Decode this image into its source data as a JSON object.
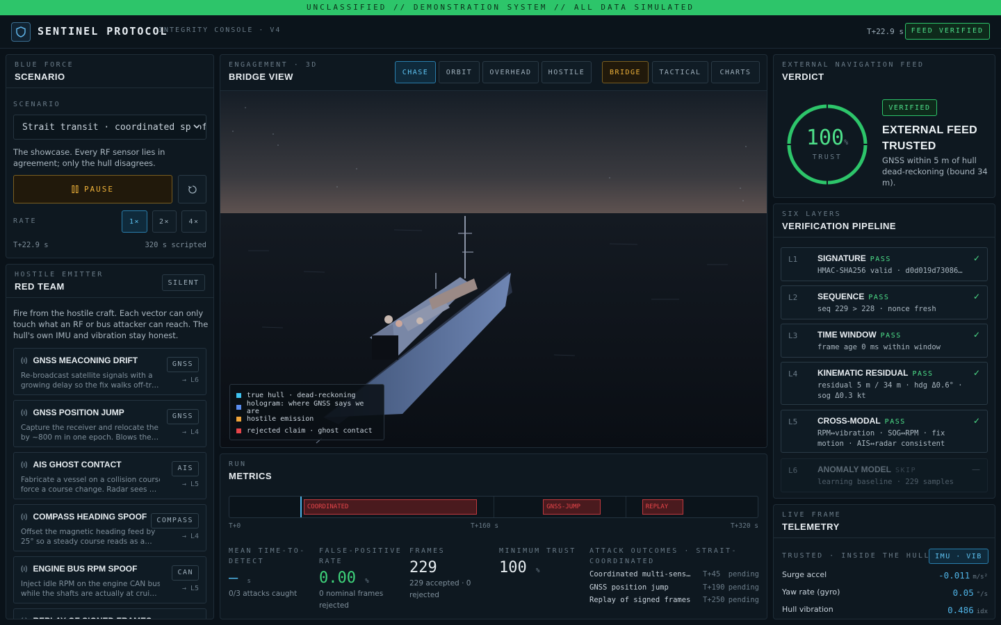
{
  "banner": "UNCLASSIFIED // DEMONSTRATION SYSTEM // ALL DATA SIMULATED",
  "header": {
    "title": "SENTINEL PROTOCOL",
    "subtitle": "INTEGRITY CONSOLE · V4",
    "clock": "T+22.9 s",
    "feed_badge": "FEED VERIFIED"
  },
  "blue_force": {
    "eyebrow": "BLUE FORCE",
    "title": "SCENARIO",
    "scenario_label": "SCENARIO",
    "scenario_value": "Strait transit · coordinated spoof",
    "scenario_desc": "The showcase. Every RF sensor lies in agreement; only the hull disagrees.",
    "pause_label": "PAUSE",
    "rate_label": "RATE",
    "rates": [
      "1×",
      "2×",
      "4×"
    ],
    "time": "T+22.9 s",
    "scripted": "320 s scripted"
  },
  "red_team": {
    "eyebrow": "HOSTILE EMITTER",
    "title": "RED TEAM",
    "status": "SILENT",
    "desc": "Fire from the hostile craft. Each vector can only touch what an RF or bus attacker can reach. The hull's own IMU and vibration stay honest.",
    "attacks": [
      {
        "name": "GNSS MEACONING DRIFT",
        "tag": "GNSS",
        "target": "→ L6",
        "line1": "Re-broadcast satellite signals with a",
        "line2": "growing delay so the fix walks off-track…"
      },
      {
        "name": "GNSS POSITION JUMP",
        "tag": "GNSS",
        "target": "→ L4",
        "line1": "Capture the receiver and relocate the fix",
        "line2": "by ~800 m in one epoch. Blows the dead…"
      },
      {
        "name": "AIS GHOST CONTACT",
        "tag": "AIS",
        "target": "→ L5",
        "line1": "Fabricate a vessel on a collision course to",
        "line2": "force a course change. Radar sees nothing…"
      },
      {
        "name": "COMPASS HEADING SPOOF",
        "tag": "COMPASS",
        "target": "→ L4",
        "line1": "Offset the magnetic heading feed by",
        "line2": "25° so a steady course reads as a…"
      },
      {
        "name": "ENGINE BUS RPM SPOOF",
        "tag": "CAN",
        "target": "→ L5",
        "line1": "Inject idle RPM on the engine CAN bus",
        "line2": "while the shafts are actually at cruise."
      },
      {
        "name": "REPLAY OF SIGNED FRAMES",
        "tag": "",
        "target": "",
        "line1": "",
        "line2": ""
      }
    ]
  },
  "engagement": {
    "eyebrow": "ENGAGEMENT · 3D",
    "title": "BRIDGE VIEW",
    "cams": [
      "CHASE",
      "ORBIT",
      "OVERHEAD",
      "HOSTILE"
    ],
    "views": [
      "BRIDGE",
      "TACTICAL",
      "CHARTS"
    ],
    "legend": [
      {
        "label": "true hull · dead-reckoning",
        "color": "#3fc3f0"
      },
      {
        "label": "hologram: where GNSS says we are",
        "color": "#5b8ef0"
      },
      {
        "label": "hostile emission",
        "color": "#f0a53a"
      },
      {
        "label": "rejected claim · ghost contact",
        "color": "#e8454a"
      }
    ]
  },
  "metrics": {
    "eyebrow": "RUN",
    "title": "METRICS",
    "timeline": {
      "start": "T+0",
      "mid": "T+160 s",
      "end": "T+320 s",
      "events": [
        {
          "label": "COORDINATED",
          "start": 45,
          "end": 150
        },
        {
          "label": "GNSS-JUMP",
          "start": 190,
          "end": 225
        },
        {
          "label": "REPLAY",
          "start": 250,
          "end": 275
        }
      ],
      "cursor": 22.9,
      "duration": 320
    },
    "mttd_label": "MEAN TIME-TO-DETECT",
    "mttd_value": "—",
    "mttd_unit": "s",
    "mttd_sub": "0/3 attacks caught",
    "fpr_label": "FALSE-POSITIVE RATE",
    "fpr_value": "0.00",
    "fpr_unit": "%",
    "fpr_sub": "0 nominal frames rejected",
    "frames_label": "FRAMES",
    "frames_value": "229",
    "frames_sub": "229 accepted · 0 rejected",
    "trust_label": "MINIMUM TRUST",
    "trust_value": "100",
    "trust_unit": "%",
    "outcomes_label": "ATTACK OUTCOMES · STRAIT-COORDINATED",
    "outcomes": [
      {
        "name": "Coordinated multi-sensor spoof",
        "time": "T+45",
        "status": "pending"
      },
      {
        "name": "GNSS position jump",
        "time": "T+190",
        "status": "pending"
      },
      {
        "name": "Replay of signed frames",
        "time": "T+250",
        "status": "pending"
      }
    ]
  },
  "verdict": {
    "eyebrow": "EXTERNAL NAVIGATION FEED",
    "title": "VERDICT",
    "trust": "100",
    "trust_fraction": 1.0,
    "trust_unit": "%",
    "trust_label": "TRUST",
    "badge": "VERIFIED",
    "headline1": "EXTERNAL FEED",
    "headline2": "TRUSTED",
    "desc": "GNSS within 5 m of hull dead-reckoning (bound 34 m).",
    "color": "#2dc56a"
  },
  "pipeline": {
    "eyebrow": "SIX LAYERS",
    "title": "VERIFICATION PIPELINE",
    "layers": [
      {
        "id": "L1",
        "name": "SIGNATURE",
        "status": "PASS",
        "l1": "HMAC-SHA256 valid · d0d019d73086…",
        "l2": ""
      },
      {
        "id": "L2",
        "name": "SEQUENCE",
        "status": "PASS",
        "l1": "seq 229 > 228 · nonce fresh",
        "l2": ""
      },
      {
        "id": "L3",
        "name": "TIME WINDOW",
        "status": "PASS",
        "l1": "frame age 0 ms within window",
        "l2": ""
      },
      {
        "id": "L4",
        "name": "KINEMATIC RESIDUAL",
        "status": "PASS",
        "l1": "residual 5 m / 34 m · hdg Δ0.6° ·",
        "l2": "sog Δ0.3 kt"
      },
      {
        "id": "L5",
        "name": "CROSS-MODAL",
        "status": "PASS",
        "l1": "RPM↔vibration · SOG↔RPM · fix",
        "l2": "motion · AIS↔radar consistent"
      },
      {
        "id": "L6",
        "name": "ANOMALY MODEL",
        "status": "SKIP",
        "l1": "learning baseline · 229 samples",
        "l2": ""
      }
    ]
  },
  "telemetry": {
    "eyebrow": "LIVE FRAME",
    "title": "TELEMETRY",
    "trusted_label": "TRUSTED · INSIDE THE HULL",
    "source_badge": "IMU · VIB",
    "rows": [
      {
        "label": "Surge accel",
        "value": "-0.011",
        "unit": "m/s²"
      },
      {
        "label": "Yaw rate (gyro)",
        "value": "0.05",
        "unit": "°/s"
      },
      {
        "label": "Hull vibration",
        "value": "0.486",
        "unit": "idx"
      }
    ]
  }
}
